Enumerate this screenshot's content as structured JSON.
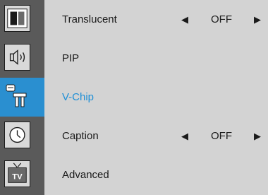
{
  "icons": [
    {
      "name": "picture-frame-icon",
      "selected": false
    },
    {
      "name": "speaker-icon",
      "selected": false
    },
    {
      "name": "tools-icon",
      "selected": true
    },
    {
      "name": "clock-icon",
      "selected": false
    },
    {
      "name": "tv-icon",
      "selected": false,
      "text": "TV"
    }
  ],
  "menu": {
    "items": [
      {
        "label": "Translucent",
        "value": "OFF",
        "arrows": true
      },
      {
        "label": "PIP"
      },
      {
        "label": "V-Chip",
        "active": true
      },
      {
        "label": "Caption",
        "value": "OFF",
        "arrows": true
      },
      {
        "label": "Advanced"
      }
    ]
  },
  "colors": {
    "background": "#d3d3d3",
    "iconbar": "#5a5a5a",
    "selected": "#2a8fd0",
    "active_text": "#1e8fd6"
  }
}
